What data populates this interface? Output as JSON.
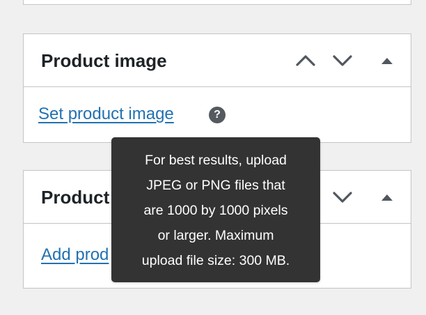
{
  "colors": {
    "page_background": "#f0f0f1",
    "panel_border": "#c3c4c7",
    "link": "#2271b1",
    "tooltip_background": "#333333",
    "help_icon": "#555a60",
    "handle_icon": "#50575e"
  },
  "product_image_box": {
    "title": "Product image",
    "set_image_link": "Set product image",
    "help_icon_glyph": "?",
    "icons": [
      "chevron-up-icon",
      "chevron-down-icon",
      "triangle-up-icon"
    ]
  },
  "tooltip": {
    "lines": [
      "For best results, upload",
      "JPEG or PNG files that",
      "are 1000 by 1000 pixels",
      "or larger. Maximum",
      "upload file size: 300 MB."
    ]
  },
  "product_gallery_box": {
    "title": "Product",
    "add_images_link": "Add prod",
    "icons": [
      "chevron-down-icon",
      "triangle-up-icon"
    ]
  }
}
